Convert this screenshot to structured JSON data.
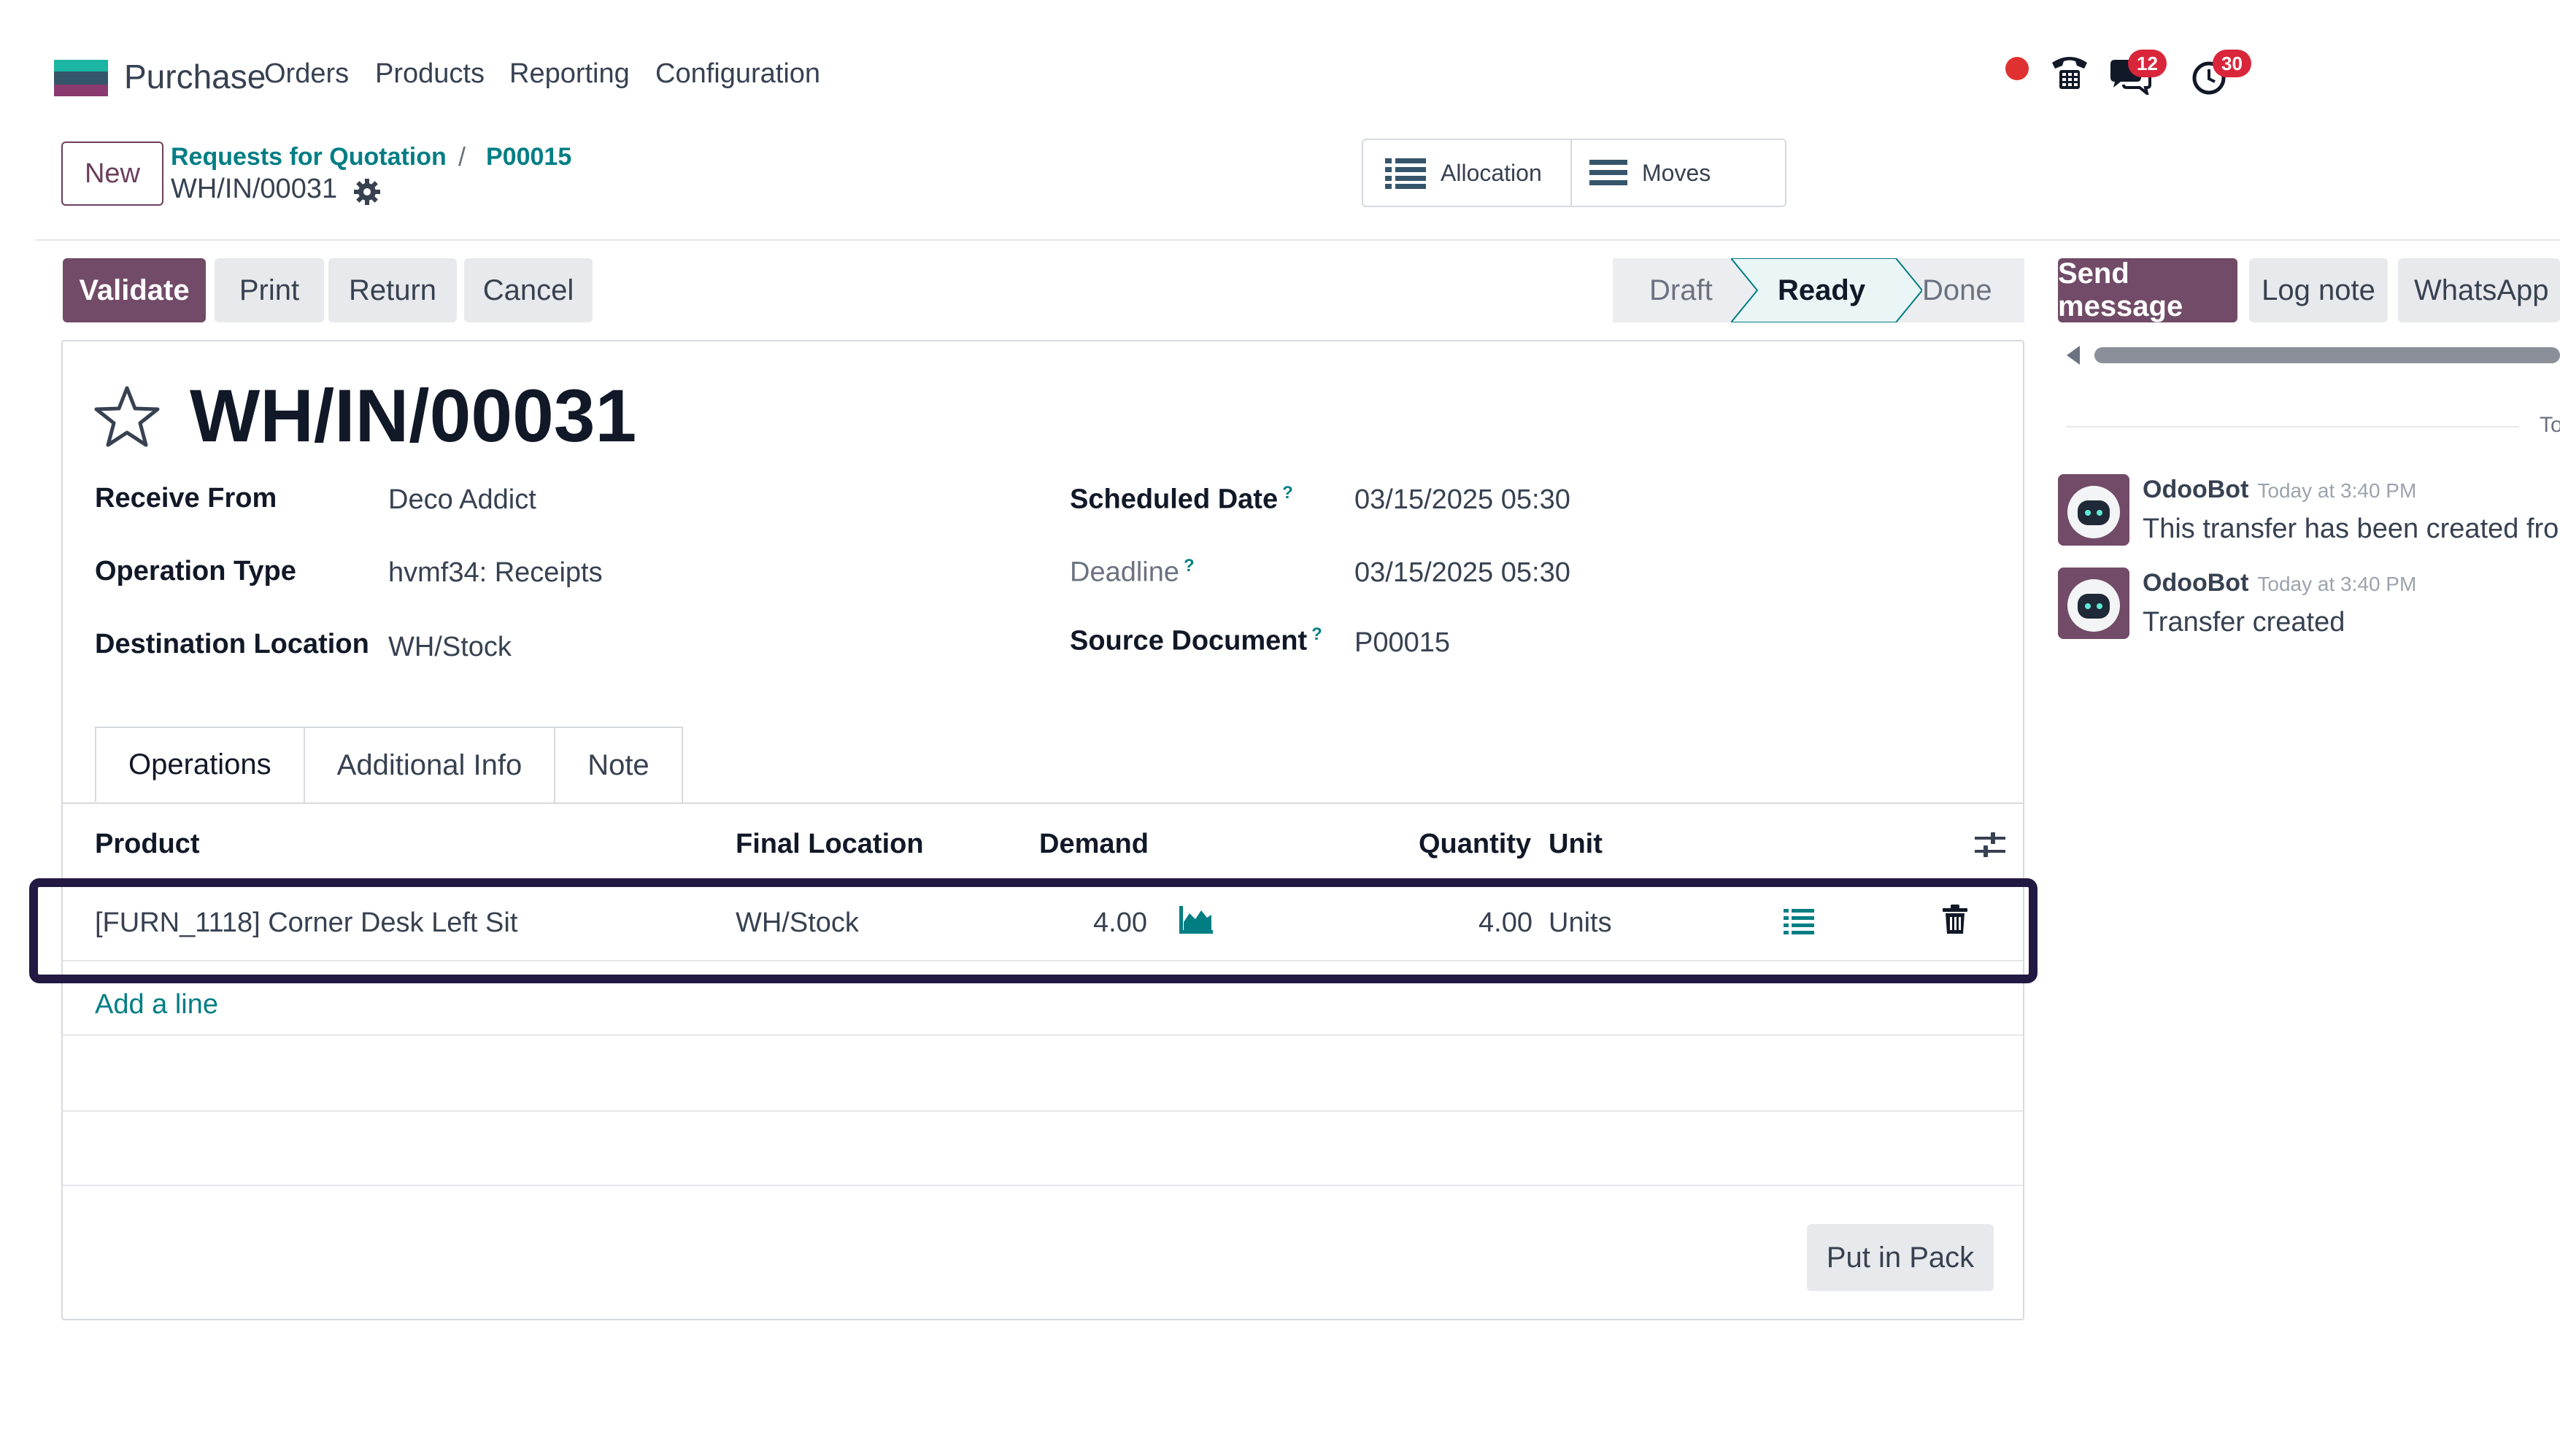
{
  "navbar": {
    "app_name": "Purchase",
    "menu": [
      "Orders",
      "Products",
      "Reporting",
      "Configuration"
    ],
    "messages_badge": "12",
    "activities_badge": "30"
  },
  "breadcrumb": {
    "new_label": "New",
    "parent": "Requests for Quotation",
    "separator": "/",
    "order": "P00015",
    "current": "WH/IN/00031"
  },
  "smart_buttons": {
    "allocation": "Allocation",
    "moves": "Moves"
  },
  "actions": {
    "validate": "Validate",
    "print": "Print",
    "return": "Return",
    "cancel": "Cancel"
  },
  "status": {
    "stages": [
      "Draft",
      "Ready",
      "Done"
    ],
    "current": "Ready"
  },
  "record": {
    "title": "WH/IN/00031",
    "fields": {
      "receive_from_label": "Receive From",
      "receive_from": "Deco Addict",
      "operation_type_label": "Operation Type",
      "operation_type": "hvmf34: Receipts",
      "destination_location_label": "Destination Location",
      "destination_location": "WH/Stock",
      "scheduled_date_label": "Scheduled Date",
      "scheduled_date": "03/15/2025 05:30",
      "deadline_label": "Deadline",
      "deadline": "03/15/2025 05:30",
      "source_document_label": "Source Document",
      "source_document": "P00015",
      "help_mark": "?"
    }
  },
  "tabs": [
    "Operations",
    "Additional Info",
    "Note"
  ],
  "table": {
    "headers": {
      "product": "Product",
      "final_location": "Final Location",
      "demand": "Demand",
      "quantity": "Quantity",
      "unit": "Unit"
    },
    "rows": [
      {
        "product": "[FURN_1118] Corner Desk Left Sit",
        "final_location": "WH/Stock",
        "demand": "4.00",
        "quantity": "4.00",
        "unit": "Units"
      }
    ],
    "add_line": "Add a line"
  },
  "footer": {
    "put_in_pack": "Put in Pack"
  },
  "chatter": {
    "send_message": "Send message",
    "log_note": "Log note",
    "whatsapp": "WhatsApp",
    "date_separator": "Today",
    "messages": [
      {
        "author": "OdooBot",
        "time": "Today at 3:40 PM",
        "body": "This transfer has been created from"
      },
      {
        "author": "OdooBot",
        "time": "Today at 3:40 PM",
        "body": "Transfer created"
      }
    ]
  },
  "colors": {
    "primary": "#714b67",
    "link": "#017e84",
    "highlight": "#231942",
    "badge": "#d9263b"
  }
}
